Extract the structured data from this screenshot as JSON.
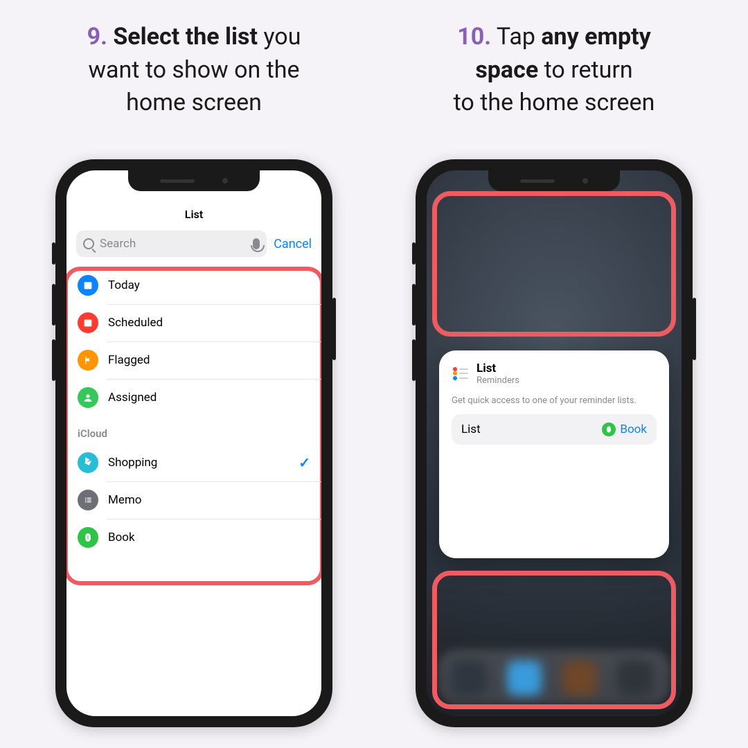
{
  "step9": {
    "number": "9.",
    "bold": "Select the list",
    "rest1": " you",
    "line2": "want to show on the",
    "line3": "home screen"
  },
  "step10": {
    "number": "10.",
    "plain1": " Tap ",
    "bold1": "any empty",
    "bold2": "space",
    "plain2": " to return",
    "line3": "to the home screen"
  },
  "phone1": {
    "sheet_title": "List",
    "search_placeholder": "Search",
    "cancel": "Cancel",
    "items_smart": [
      {
        "label": "Today",
        "icon": "today",
        "color": "blue"
      },
      {
        "label": "Scheduled",
        "icon": "calendar",
        "color": "red"
      },
      {
        "label": "Flagged",
        "icon": "flag",
        "color": "orange"
      },
      {
        "label": "Assigned",
        "icon": "person",
        "color": "green"
      }
    ],
    "section": "iCloud",
    "items_icloud": [
      {
        "label": "Shopping",
        "icon": "cart",
        "color": "teal",
        "checked": true
      },
      {
        "label": "Memo",
        "icon": "list",
        "color": "grey"
      },
      {
        "label": "Book",
        "icon": "leaf",
        "color": "lime"
      }
    ]
  },
  "phone2": {
    "widget": {
      "title": "List",
      "subtitle": "Reminders",
      "desc": "Get quick access to one of your reminder lists.",
      "row_key": "List",
      "row_value": "Book"
    }
  }
}
